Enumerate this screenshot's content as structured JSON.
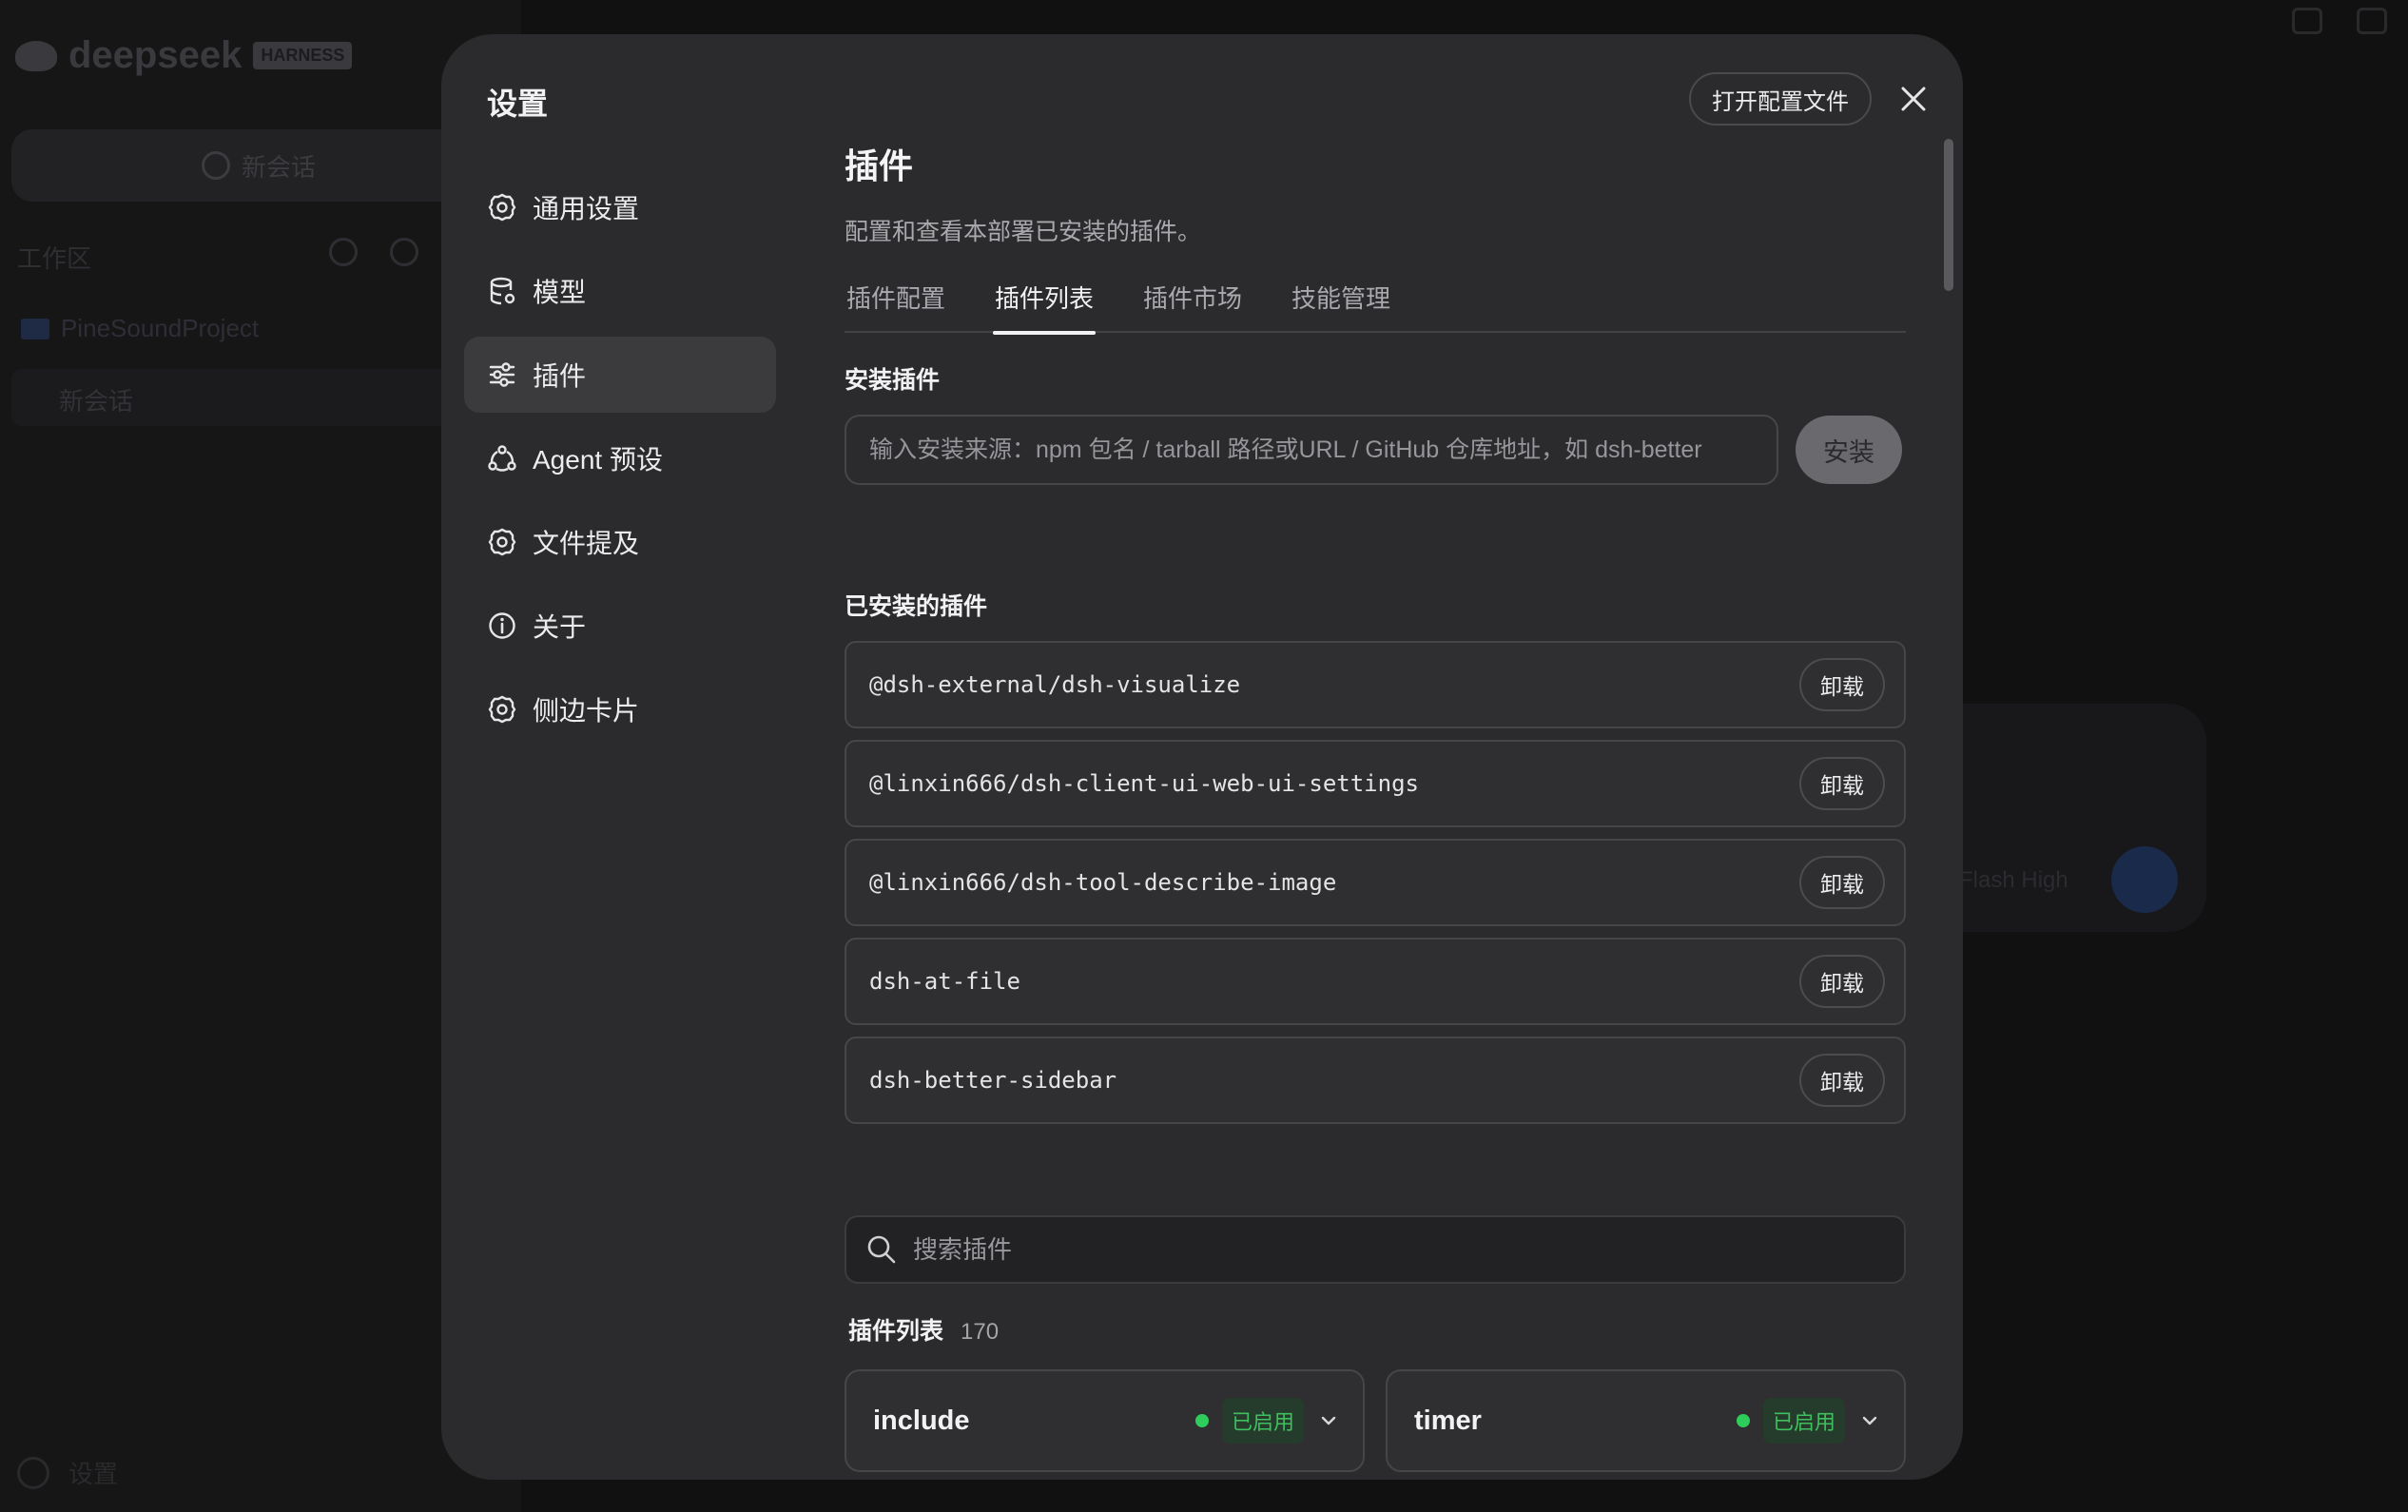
{
  "background": {
    "brand": "deepseek",
    "brand_badge": "HARNESS",
    "new_chat_label": "新会话",
    "workspace_label": "工作区",
    "project_name": "PineSoundProject",
    "chat_item": "新会话",
    "settings_label": "设置",
    "model_hint": "Flash High"
  },
  "modal": {
    "title": "设置",
    "open_config_label": "打开配置文件",
    "nav": [
      {
        "label": "通用设置",
        "icon": "gear-icon"
      },
      {
        "label": "模型",
        "icon": "database-icon"
      },
      {
        "label": "插件",
        "icon": "sliders-icon",
        "active": true
      },
      {
        "label": "Agent 预设",
        "icon": "agent-icon"
      },
      {
        "label": "文件提及",
        "icon": "gear-icon"
      },
      {
        "label": "关于",
        "icon": "info-icon"
      },
      {
        "label": "侧边卡片",
        "icon": "gear-icon"
      }
    ]
  },
  "plugins": {
    "heading": "插件",
    "description": "配置和查看本部署已安装的插件。",
    "tabs": [
      "插件配置",
      "插件列表",
      "插件市场",
      "技能管理"
    ],
    "active_tab": "插件列表",
    "install_label": "安装插件",
    "install_placeholder": "输入安装来源：npm 包名 / tarball 路径或URL / GitHub 仓库地址，如 dsh-better",
    "install_button": "安装",
    "installed_label": "已安装的插件",
    "installed": [
      "@dsh-external/dsh-visualize",
      "@linxin666/dsh-client-ui-web-ui-settings",
      "@linxin666/dsh-tool-describe-image",
      "dsh-at-file",
      "dsh-better-sidebar"
    ],
    "uninstall_label": "卸载",
    "search_placeholder": "搜索插件",
    "list_label": "插件列表",
    "list_count": "170",
    "cards": [
      {
        "name": "include",
        "status": "已启用"
      },
      {
        "name": "timer",
        "status": "已启用"
      }
    ]
  },
  "colors": {
    "modal_bg": "#2b2b2d",
    "accent_green": "#2ecc5a",
    "active_nav": "#3b3b3e"
  }
}
